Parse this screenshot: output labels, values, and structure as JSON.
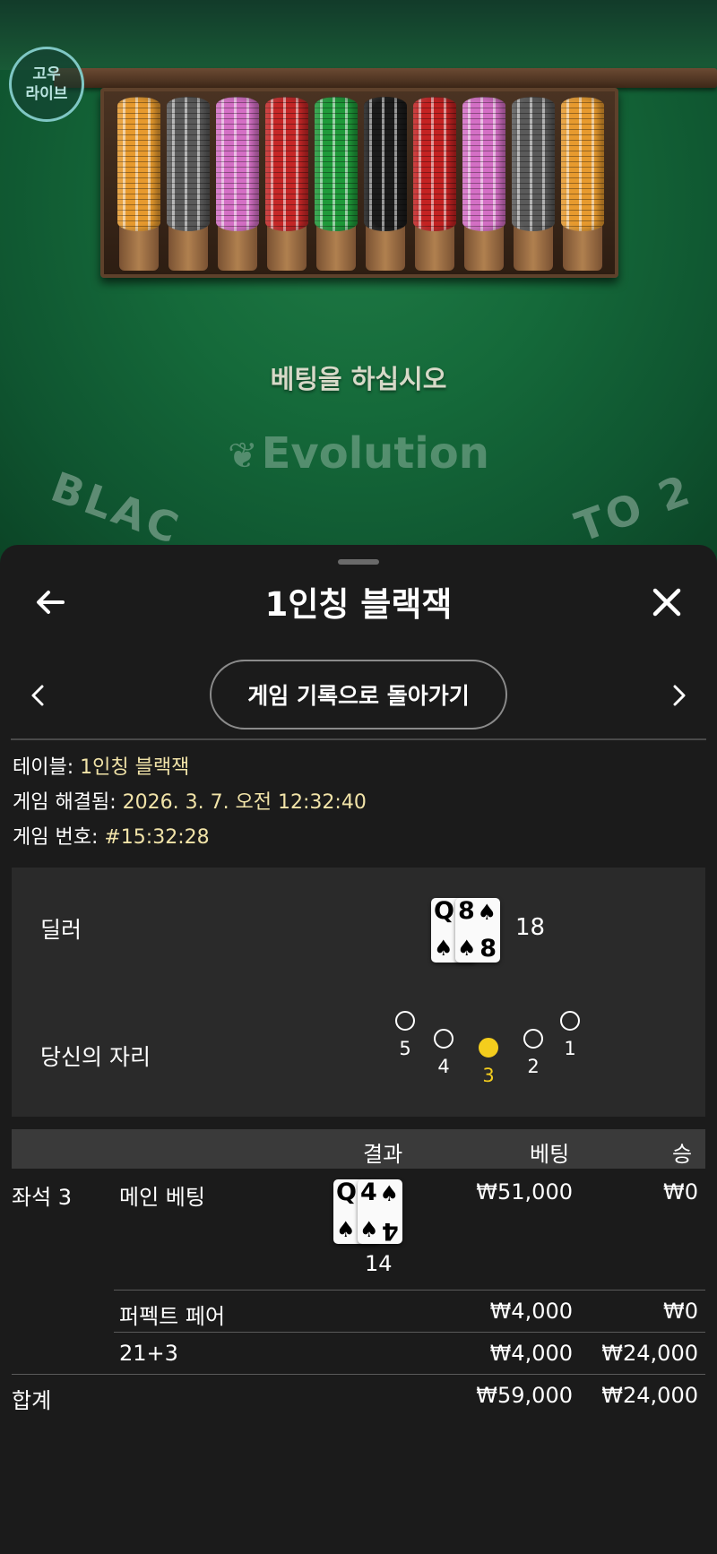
{
  "game_scene": {
    "logo_line1": "고우",
    "logo_line2": "라이브",
    "bet_prompt": "베팅을 하십시오",
    "provider_logo": "Evolution",
    "table_arc_left": "BLAC",
    "table_arc_right": "TO 2",
    "chip_colors": [
      "#e79a2e",
      "#5a5a5a",
      "#d46fc5",
      "#c62727",
      "#1f9a3a",
      "#1b1b1b",
      "#c42222",
      "#d46fc5",
      "#5a5a5a",
      "#e79a2e"
    ]
  },
  "sheet": {
    "title": "1인칭 블랙잭",
    "back_icon": "arrow-left-icon",
    "close_icon": "close-icon",
    "history_button": "게임 기록으로 돌아가기",
    "meta": {
      "table_label": "테이블: ",
      "table_value": "1인칭 블랙잭",
      "resolved_label": "게임 해결됨: ",
      "resolved_value": "2026. 3. 7. 오전 12:32:40",
      "number_label": "게임 번호: ",
      "number_value": "#15:32:28"
    },
    "dealer": {
      "label": "딜러",
      "cards": [
        {
          "rank": "Q",
          "suit": "♠"
        },
        {
          "rank": "8",
          "suit": "♠"
        }
      ],
      "total": "18"
    },
    "seats": {
      "label": "당신의 자리",
      "numbers": [
        "5",
        "4",
        "3",
        "2",
        "1"
      ],
      "selected": "3"
    },
    "table": {
      "headers": {
        "result": "결과",
        "bet": "베팅",
        "win": "승"
      },
      "seat_label": "좌석 3",
      "rows": [
        {
          "name": "메인 베팅",
          "bet": "₩51,000",
          "win": "₩0",
          "cards": [
            {
              "rank": "Q",
              "suit": "♠"
            },
            {
              "rank": "4",
              "suit": "♠"
            }
          ],
          "total": "14"
        },
        {
          "name": "퍼펙트 페어",
          "bet": "₩4,000",
          "win": "₩0"
        },
        {
          "name": "21+3",
          "bet": "₩4,000",
          "win": "₩24,000"
        }
      ],
      "total": {
        "label": "합계",
        "bet": "₩59,000",
        "win": "₩24,000"
      }
    },
    "accent_yellow": "#f4cd1d",
    "value_color": "#f1e3a8"
  }
}
